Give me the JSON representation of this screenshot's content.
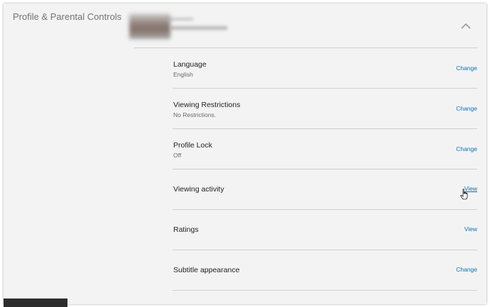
{
  "section": {
    "title": "Profile & Parental Controls"
  },
  "rows": [
    {
      "label": "Language",
      "value": "English",
      "action": "Change"
    },
    {
      "label": "Viewing Restrictions",
      "value": "No Restrictions.",
      "action": "Change"
    },
    {
      "label": "Profile Lock",
      "value": "Off",
      "action": "Change"
    },
    {
      "label": "Viewing activity",
      "action": "View"
    },
    {
      "label": "Ratings",
      "action": "View"
    },
    {
      "label": "Subtitle appearance",
      "action": "Change"
    }
  ],
  "colors": {
    "panel_bg": "#f3f3f3",
    "link": "#0a73b7",
    "divider": "#cfcfcf"
  },
  "icons": {
    "collapse": "chevron-up-icon",
    "pointer": "hand-cursor-icon"
  }
}
